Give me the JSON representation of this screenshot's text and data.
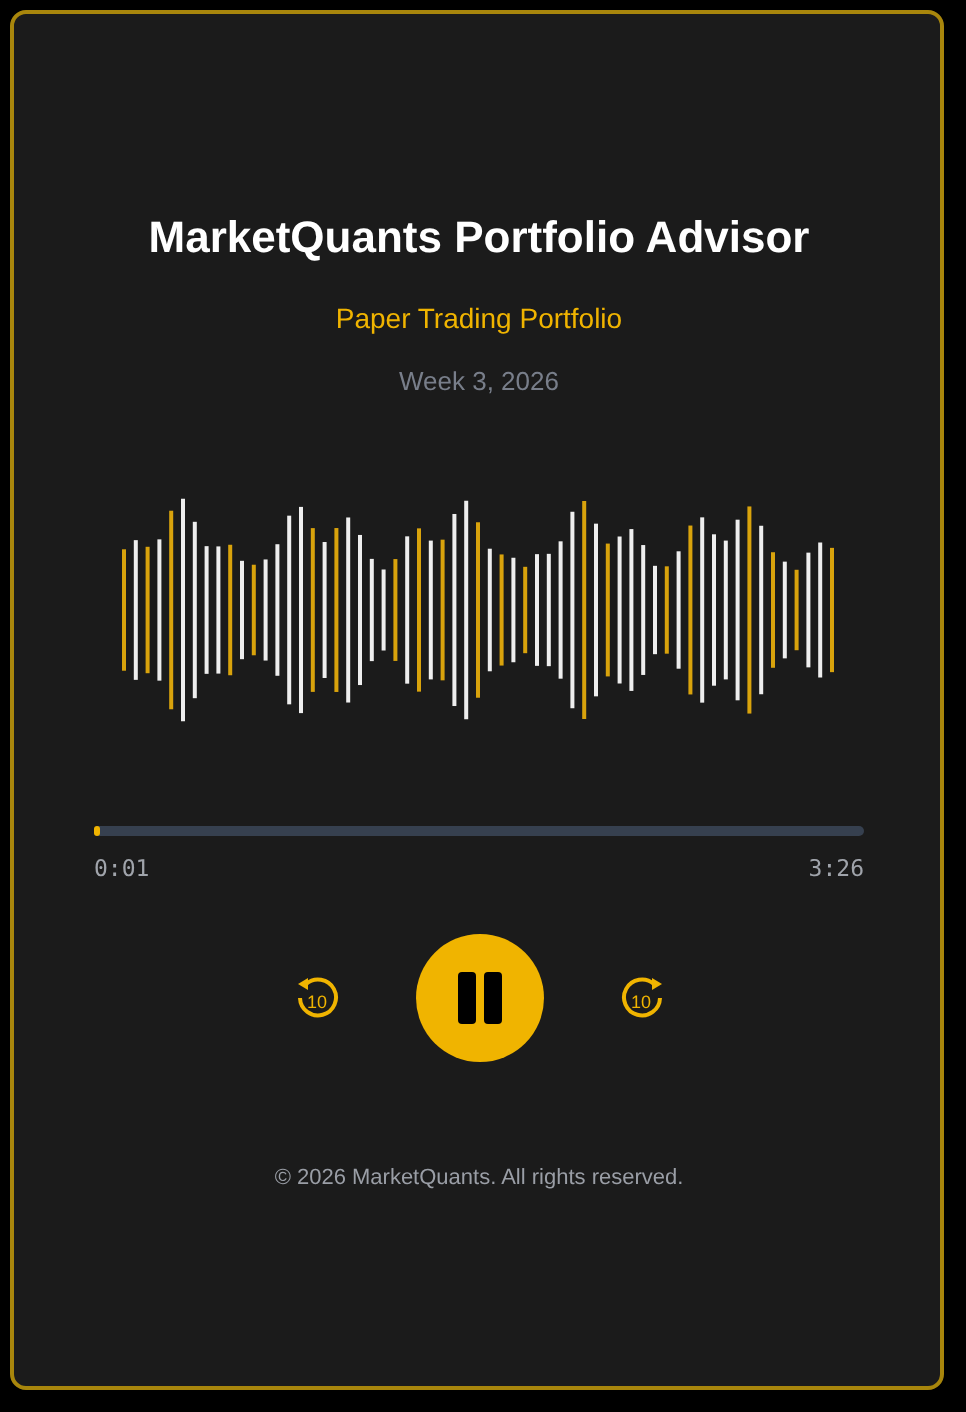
{
  "title": "MarketQuants Portfolio Advisor",
  "subtitle": "Paper Trading Portfolio",
  "date": "Week 3, 2026",
  "player": {
    "rewind": "10",
    "forward": "10",
    "playing": true,
    "level": 0.008,
    "elapsed": "0:01",
    "duration": "3:26"
  },
  "footer": "© 2026 MarketQuants. All rights reserved."
}
